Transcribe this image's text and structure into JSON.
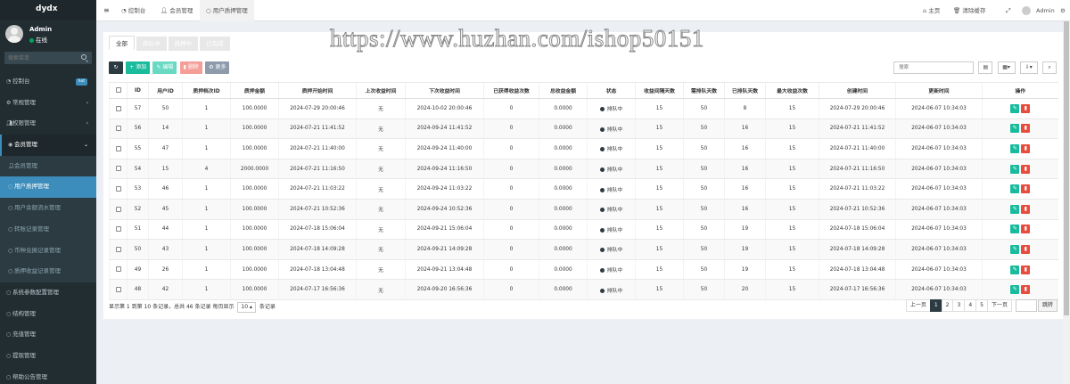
{
  "brand": "dydx",
  "user": {
    "name": "Admin",
    "status": "在线"
  },
  "sidebar_search_placeholder": "搜索菜单",
  "menu": [
    {
      "label": "控制台",
      "icon": "dashboard-icon",
      "badge": "hot"
    },
    {
      "label": "常规管理",
      "icon": "cogs-icon",
      "arrow": "‹"
    },
    {
      "label": "权限管理",
      "icon": "group-icon",
      "arrow": "‹"
    },
    {
      "label": "会员管理",
      "icon": "user-circle-icon",
      "arrow": "⌄",
      "open": true
    },
    {
      "label": "会员管理",
      "icon": "user-icon",
      "sub": true
    },
    {
      "label": "用户质押管理",
      "icon": "circle-icon",
      "sub": true,
      "active": true
    },
    {
      "label": "用户余额流水管理",
      "icon": "circle-icon",
      "sub": true
    },
    {
      "label": "转账记录管理",
      "icon": "circle-icon",
      "sub": true
    },
    {
      "label": "币种兑换记录管理",
      "icon": "circle-icon",
      "sub": true
    },
    {
      "label": "质押收益记录管理",
      "icon": "circle-icon",
      "sub": true
    },
    {
      "label": "系统参数配置管理",
      "icon": "circle-icon"
    },
    {
      "label": "结构管理",
      "icon": "circle-icon"
    },
    {
      "label": "充值管理",
      "icon": "circle-icon"
    },
    {
      "label": "提现管理",
      "icon": "circle-icon"
    },
    {
      "label": "帮助公告管理",
      "icon": "circle-icon"
    }
  ],
  "topbar": {
    "crumbs": [
      "控制台",
      "会员管理",
      "用户质押管理"
    ],
    "home": "主页",
    "clear_cache": "清除缓存",
    "admin": "Admin"
  },
  "watermark": "https://www.huzhan.com/ishop50151",
  "tabs": [
    "全部",
    "排队中",
    "质押中",
    "已完成"
  ],
  "toolbar": {
    "add": "添加",
    "edit": "编辑",
    "del": "删除",
    "more": "更多"
  },
  "search_placeholder": "搜索",
  "table": {
    "headers": [
      "ID",
      "用户ID",
      "质押档次ID",
      "质押金额",
      "质押开始时间",
      "上次收益时间",
      "下次收益时间",
      "已获得收益次数",
      "总收益金额",
      "状态",
      "收益间隔天数",
      "需排队天数",
      "已排队天数",
      "最大收益次数",
      "创建时间",
      "更新时间",
      "操作"
    ],
    "rows": [
      [
        "57",
        "50",
        "1",
        "100.0000",
        "2024-07-29 20:00:46",
        "无",
        "2024-10-02 20:00:46",
        "0",
        "0.0000",
        "排队中",
        "15",
        "50",
        "8",
        "15",
        "2024-07-29 20:00:46",
        "2024-06-07 10:34:03"
      ],
      [
        "56",
        "14",
        "1",
        "100.0000",
        "2024-07-21 11:41:52",
        "无",
        "2024-09-24 11:41:52",
        "0",
        "0.0000",
        "排队中",
        "15",
        "50",
        "16",
        "15",
        "2024-07-21 11:41:52",
        "2024-06-07 10:34:03"
      ],
      [
        "55",
        "47",
        "1",
        "100.0000",
        "2024-07-21 11:40:00",
        "无",
        "2024-09-24 11:40:00",
        "0",
        "0.0000",
        "排队中",
        "15",
        "50",
        "16",
        "15",
        "2024-07-21 11:40:00",
        "2024-06-07 10:34:03"
      ],
      [
        "54",
        "15",
        "4",
        "2000.0000",
        "2024-07-21 11:16:50",
        "无",
        "2024-09-24 11:16:50",
        "0",
        "0.0000",
        "排队中",
        "15",
        "50",
        "16",
        "15",
        "2024-07-21 11:16:50",
        "2024-06-07 10:34:03"
      ],
      [
        "53",
        "46",
        "1",
        "100.0000",
        "2024-07-21 11:03:22",
        "无",
        "2024-09-24 11:03:22",
        "0",
        "0.0000",
        "排队中",
        "15",
        "50",
        "16",
        "15",
        "2024-07-21 11:03:22",
        "2024-06-07 10:34:03"
      ],
      [
        "52",
        "45",
        "1",
        "100.0000",
        "2024-07-21 10:52:36",
        "无",
        "2024-09-24 10:52:36",
        "0",
        "0.0000",
        "排队中",
        "15",
        "50",
        "16",
        "15",
        "2024-07-21 10:52:36",
        "2024-06-07 10:34:03"
      ],
      [
        "51",
        "44",
        "1",
        "100.0000",
        "2024-07-18 15:06:04",
        "无",
        "2024-09-21 15:06:04",
        "0",
        "0.0000",
        "排队中",
        "15",
        "50",
        "19",
        "15",
        "2024-07-18 15:06:04",
        "2024-06-07 10:34:03"
      ],
      [
        "50",
        "43",
        "1",
        "100.0000",
        "2024-07-18 14:09:28",
        "无",
        "2024-09-21 14:09:28",
        "0",
        "0.0000",
        "排队中",
        "15",
        "50",
        "19",
        "15",
        "2024-07-18 14:09:28",
        "2024-06-07 10:34:03"
      ],
      [
        "49",
        "26",
        "1",
        "100.0000",
        "2024-07-18 13:04:48",
        "无",
        "2024-09-21 13:04:48",
        "0",
        "0.0000",
        "排队中",
        "15",
        "50",
        "19",
        "15",
        "2024-07-18 13:04:48",
        "2024-06-07 10:34:03"
      ],
      [
        "48",
        "42",
        "1",
        "100.0000",
        "2024-07-17 16:56:36",
        "无",
        "2024-09-20 16:56:36",
        "0",
        "0.0000",
        "排队中",
        "15",
        "50",
        "20",
        "15",
        "2024-07-17 16:56:36",
        "2024-06-07 10:34:03"
      ]
    ]
  },
  "pagination": {
    "info_prefix": "显示第 1 到第 10 条记录，总共 46 条记录 每页显示",
    "page_size": "10 ▴",
    "info_suffix": "条记录",
    "prev": "上一页",
    "pages": [
      "1",
      "2",
      "3",
      "4",
      "5"
    ],
    "next": "下一页",
    "go": "跳转"
  },
  "colors": {
    "sidebar": "#222d32",
    "active": "#3c8dbc",
    "success": "#18bc9c",
    "danger": "#e74c3c"
  }
}
